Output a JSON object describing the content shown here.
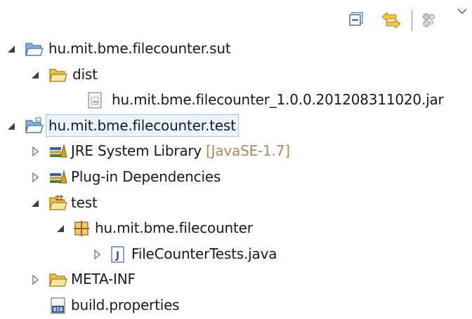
{
  "toolbar": {
    "buttons": [
      {
        "icon": "collapse-all-icon"
      },
      {
        "icon": "link-with-editor-icon"
      },
      {
        "icon": "filter-icon"
      },
      {
        "icon": "view-menu-chevron-icon"
      }
    ]
  },
  "tree": [
    {
      "label": "hu.mit.bme.filecounter.sut",
      "icon": "project-folder-icon",
      "level": 0,
      "expanded": true
    },
    {
      "label": "dist",
      "icon": "folder-icon",
      "level": 1,
      "expanded": true
    },
    {
      "label": "hu.mit.bme.filecounter_1.0.0.201208311020.jar",
      "icon": "jar-file-icon",
      "level": 2
    },
    {
      "label": "hu.mit.bme.filecounter.test",
      "icon": "plugin-project-icon",
      "level": 0,
      "expanded": true,
      "selected": true
    },
    {
      "label": "JRE System Library",
      "decoration": "[JavaSE-1.7]",
      "icon": "library-icon",
      "level": 1,
      "expanded": false
    },
    {
      "label": "Plug-in Dependencies",
      "icon": "library-icon",
      "level": 1,
      "expanded": false
    },
    {
      "label": "test",
      "icon": "source-folder-icon",
      "level": 1,
      "expanded": true
    },
    {
      "label": "hu.mit.bme.filecounter",
      "icon": "package-icon",
      "level": 2,
      "expanded": true
    },
    {
      "label": "FileCounterTests.java",
      "icon": "java-file-icon",
      "level": 3,
      "expanded": false
    },
    {
      "label": "META-INF",
      "icon": "folder-icon",
      "level": 1,
      "expanded": false
    },
    {
      "label": "build.properties",
      "icon": "properties-file-icon",
      "level": 1
    }
  ]
}
